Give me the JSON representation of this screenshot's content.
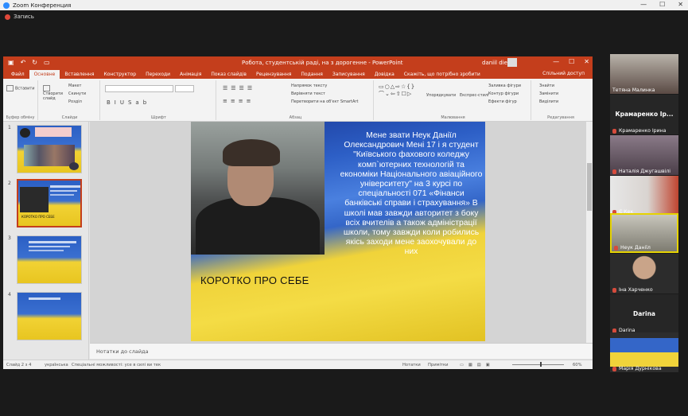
{
  "zoom": {
    "title": "Zoom Конференция",
    "recording": "Запись",
    "window_controls": [
      "—",
      "☐",
      "✕"
    ]
  },
  "ppt": {
    "doc_title": "Робота, студентській раді, на з дорогенне - PowerPoint",
    "user": "daniil diesel",
    "window_controls": [
      "—",
      "☐",
      "✕"
    ],
    "tabs": [
      "Файл",
      "Основне",
      "Вставлення",
      "Конструктор",
      "Переходи",
      "Анімація",
      "Показ слайдів",
      "Рецензування",
      "Подання",
      "Записування",
      "Довідка",
      "Скажіть, що потрібно зробити"
    ],
    "active_tab": "Основне",
    "share_label": "Спільний доступ",
    "ribbon": {
      "groups": [
        "Буфер обміну",
        "Слайди",
        "Шрифт",
        "Абзац",
        "Малювання",
        "Редагування"
      ],
      "paste_label": "Вставити",
      "new_slide_label": "Створити слайд",
      "layout_label": "Макет",
      "reset_label": "Скинути",
      "section_label": "Розділ",
      "text_direction_label": "Напрямок тексту",
      "align_text_label": "Вирівняти текст",
      "convert_smartart_label": "Перетворити на об'єкт SmartArt",
      "arrange_label": "Упорядкувати",
      "quick_styles_label": "Експрес-стилі",
      "shape_fill_label": "Заливка фігури",
      "shape_outline_label": "Контур фігури",
      "shape_effects_label": "Ефекти фігур",
      "find_label": "Знайти",
      "replace_label": "Замінити",
      "select_label": "Виділити"
    },
    "thumbnails": [
      {
        "num": "1",
        "caption": ""
      },
      {
        "num": "2",
        "caption": "КОРОТКО ПРО СЕБЕ"
      },
      {
        "num": "3",
        "caption": ""
      },
      {
        "num": "4",
        "caption": ""
      }
    ],
    "selected_slide": "2",
    "slide": {
      "caption": "КОРОТКО ПРО СЕБЕ",
      "bio": "Мене звати Неук Даніїл Олександрович Мені 17 і я студент \"Київського фахового коледжу комп`ютерних технологій та економіки Національного авіаційного університету\" на 3 курсі по спеціальності 071 «Фінанси банківські справи і страхування» В школі мав завжди авторитет з боку всіх вчителів а також адміністрації школи, тому завжди коли робились якісь заходи мене заохочували до них"
    },
    "notes_placeholder": "Нотатки до слайда",
    "status": {
      "slide_counter": "Слайд 2 з 4",
      "language": "українська",
      "accessibility": "Спеціальні можливості: усе в силі ви тек",
      "notes_btn": "Нотатки",
      "comments_btn": "Примітки",
      "zoom": "60%"
    }
  },
  "participants": [
    {
      "name": "Тетяна Малинка",
      "label_only": false,
      "muted": false,
      "color": "#5a4a44"
    },
    {
      "name": "Крамаренко Ірина",
      "big": "Крамаренко Ір...",
      "label_only": true,
      "muted": true,
      "color": "#262626"
    },
    {
      "name": "Наталія Джугашвілі",
      "label_only": false,
      "muted": true,
      "color": "#6a5866"
    },
    {
      "name": "Є Кек",
      "label_only": false,
      "muted": true,
      "color": "#b84a3a"
    },
    {
      "name": "Неук Даніїл",
      "label_only": false,
      "muted": true,
      "color": "#7a7a6a",
      "active": true
    },
    {
      "name": "Іна Харченко",
      "label_only": false,
      "muted": true,
      "color": "#3a3a3a"
    },
    {
      "name": "Darina",
      "big": "Darina",
      "label_only": true,
      "muted": true,
      "color": "#262626"
    },
    {
      "name": "Марія Дурнікова",
      "label_only": false,
      "muted": true,
      "color": "#5a6a7a"
    }
  ]
}
